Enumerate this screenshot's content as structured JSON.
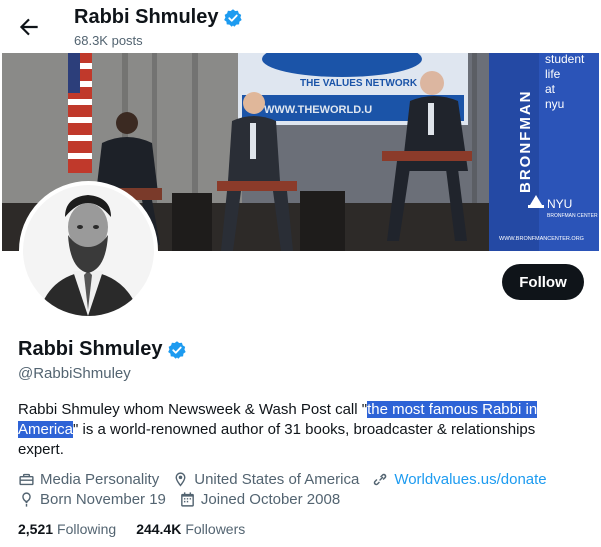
{
  "header": {
    "name": "Rabbi Shmuley",
    "posts": "68.3K posts"
  },
  "banner": {
    "sign_text": "THE VALUES NETWORK",
    "sign_url": "WWW.THEWORLD.U",
    "side_banner": "BRONFMAN",
    "side_lines": [
      "student",
      "life",
      "at",
      "nyu"
    ],
    "nyu_logo": "NYU",
    "nyu_sub": "BRONFMAN CENTER",
    "footer_url": "WWW.BRONFMANCENTER.ORG"
  },
  "actions": {
    "follow_label": "Follow"
  },
  "profile": {
    "name": "Rabbi Shmuley",
    "handle": "@RabbiShmuley",
    "bio_part1": "Rabbi Shmuley whom Newsweek & Wash Post call \"",
    "bio_highlight_1": "the most famous Rabbi in",
    "bio_highlight_2": "America",
    "bio_part2": "\" is a world-renowned author of 31 books, broadcaster & relationships expert.",
    "category": "Media Personality",
    "location": "United States of America",
    "website": "Worldvalues.us/donate",
    "born": "Born November 19",
    "joined": "Joined October 2008"
  },
  "stats": {
    "following_count": "2,521",
    "following_label": "Following",
    "followers_count": "244.4K",
    "followers_label": "Followers"
  },
  "colors": {
    "verified": "#1d9bf0",
    "link": "#1d9bf0",
    "highlight": "#2e63d6",
    "text": "#0f1419",
    "muted": "#536471"
  }
}
